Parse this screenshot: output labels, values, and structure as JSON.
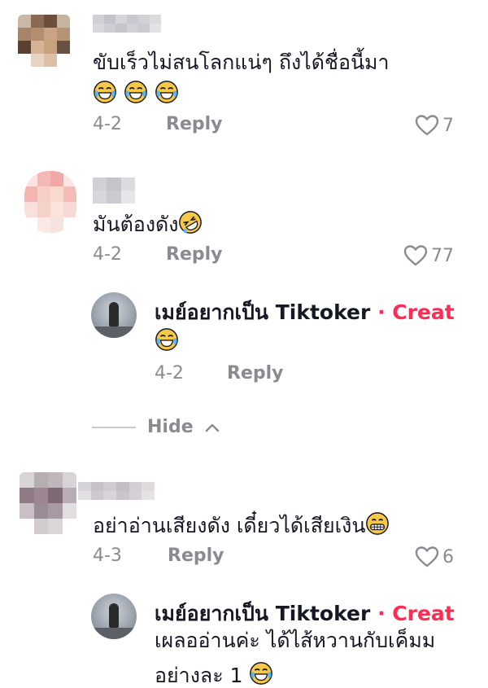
{
  "comments": [
    {
      "text": "ขับเร็วไม่สนโลกแน่ๆ ถึงได้ชื่อนี้มา",
      "emoji_count": 3,
      "emoji": "tears-of-joy",
      "date": "4-2",
      "reply": "Reply",
      "likes": "7"
    },
    {
      "text": "มันต้องดัง",
      "emoji": "rolling-laughing",
      "date": "4-2",
      "reply": "Reply",
      "likes": "77"
    },
    {
      "text": "อย่าอ่านเสียงดัง เดี๋ยวได้เสียเงิน",
      "emoji": "grinning",
      "date": "4-3",
      "reply": "Reply",
      "likes": "6"
    }
  ],
  "replies": [
    {
      "author": "เมย์อยากเป็น Tiktoker",
      "badge": "· Creat",
      "emoji": "tears-of-joy",
      "date": "4-2",
      "reply": "Reply"
    },
    {
      "author": "เมย์อยากเป็น Tiktoker",
      "badge": "· Creat",
      "line1": "เผลออ่านค่ะ ได้ไส้หวานกับเค็มม",
      "line2": "อย่างละ 1",
      "emoji": "tears-of-joy"
    }
  ],
  "hide": {
    "label": "Hide",
    "icon": "chevron-up-icon"
  },
  "colors": {
    "creator": "#fe2c55",
    "muted": "#8a8b91",
    "text": "#161823"
  }
}
